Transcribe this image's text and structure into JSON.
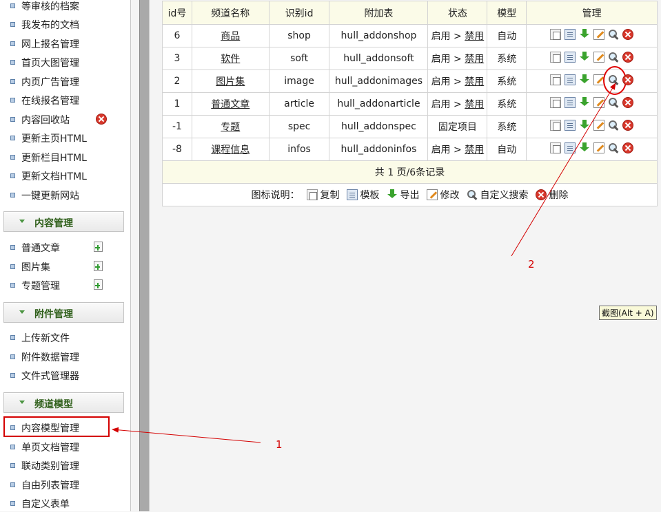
{
  "sidebar": {
    "group0": [
      "等审核的档案",
      "我发布的文档",
      "网上报名管理",
      "首页大图管理",
      "内页广告管理",
      "在线报名管理",
      "内容回收站",
      "更新主页HTML",
      "更新栏目HTML",
      "更新文档HTML",
      "一键更新网站"
    ],
    "section_content": {
      "title": "内容管理",
      "items": [
        "普通文章",
        "图片集",
        "专题管理"
      ]
    },
    "section_attach": {
      "title": "附件管理",
      "items": [
        "上传新文件",
        "附件数据管理",
        "文件式管理器"
      ]
    },
    "section_channel": {
      "title": "频道模型",
      "items": [
        "内容模型管理",
        "单页文档管理",
        "联动类别管理",
        "自由列表管理",
        "自定义表单"
      ]
    }
  },
  "table": {
    "headers": [
      "id号",
      "频道名称",
      "识别id",
      "附加表",
      "状态",
      "模型",
      "管理"
    ],
    "rows": [
      {
        "id": "6",
        "name": "商品",
        "nid": "shop",
        "table": "hull_addonshop",
        "status_on": "启用",
        "sep": " > ",
        "status_off": "禁用",
        "model": "自动"
      },
      {
        "id": "3",
        "name": "软件",
        "nid": "soft",
        "table": "hull_addonsoft",
        "status_on": "启用",
        "sep": " > ",
        "status_off": "禁用",
        "model": "系统"
      },
      {
        "id": "2",
        "name": "图片集",
        "nid": "image",
        "table": "hull_addonimages",
        "status_on": "启用",
        "sep": " > ",
        "status_off": "禁用",
        "model": "系统"
      },
      {
        "id": "1",
        "name": "普通文章",
        "nid": "article",
        "table": "hull_addonarticle",
        "status_on": "启用",
        "sep": " > ",
        "status_off": "禁用",
        "model": "系统"
      },
      {
        "id": "-1",
        "name": "专题",
        "nid": "spec",
        "table": "hull_addonspec",
        "status_fixed": "固定项目",
        "model": "系统"
      },
      {
        "id": "-8",
        "name": "课程信息",
        "nid": "infos",
        "table": "hull_addoninfos",
        "status_on": "启用",
        "sep": " > ",
        "status_off": "禁用",
        "model": "自动"
      }
    ],
    "pager": "共 1 页/6条记录",
    "legend": {
      "prefix": "图标说明：",
      "copy": "复制",
      "template": "模板",
      "export": "导出",
      "edit": "修改",
      "search": "自定义搜索",
      "delete": "删除"
    }
  },
  "annotations": {
    "label1": "1",
    "label2": "2",
    "tooltip": "截图(Alt + A)"
  },
  "colors": {
    "highlight_red": "#d40000",
    "header_bg": "#fbfbe8",
    "section_title": "#2f5f1a"
  }
}
